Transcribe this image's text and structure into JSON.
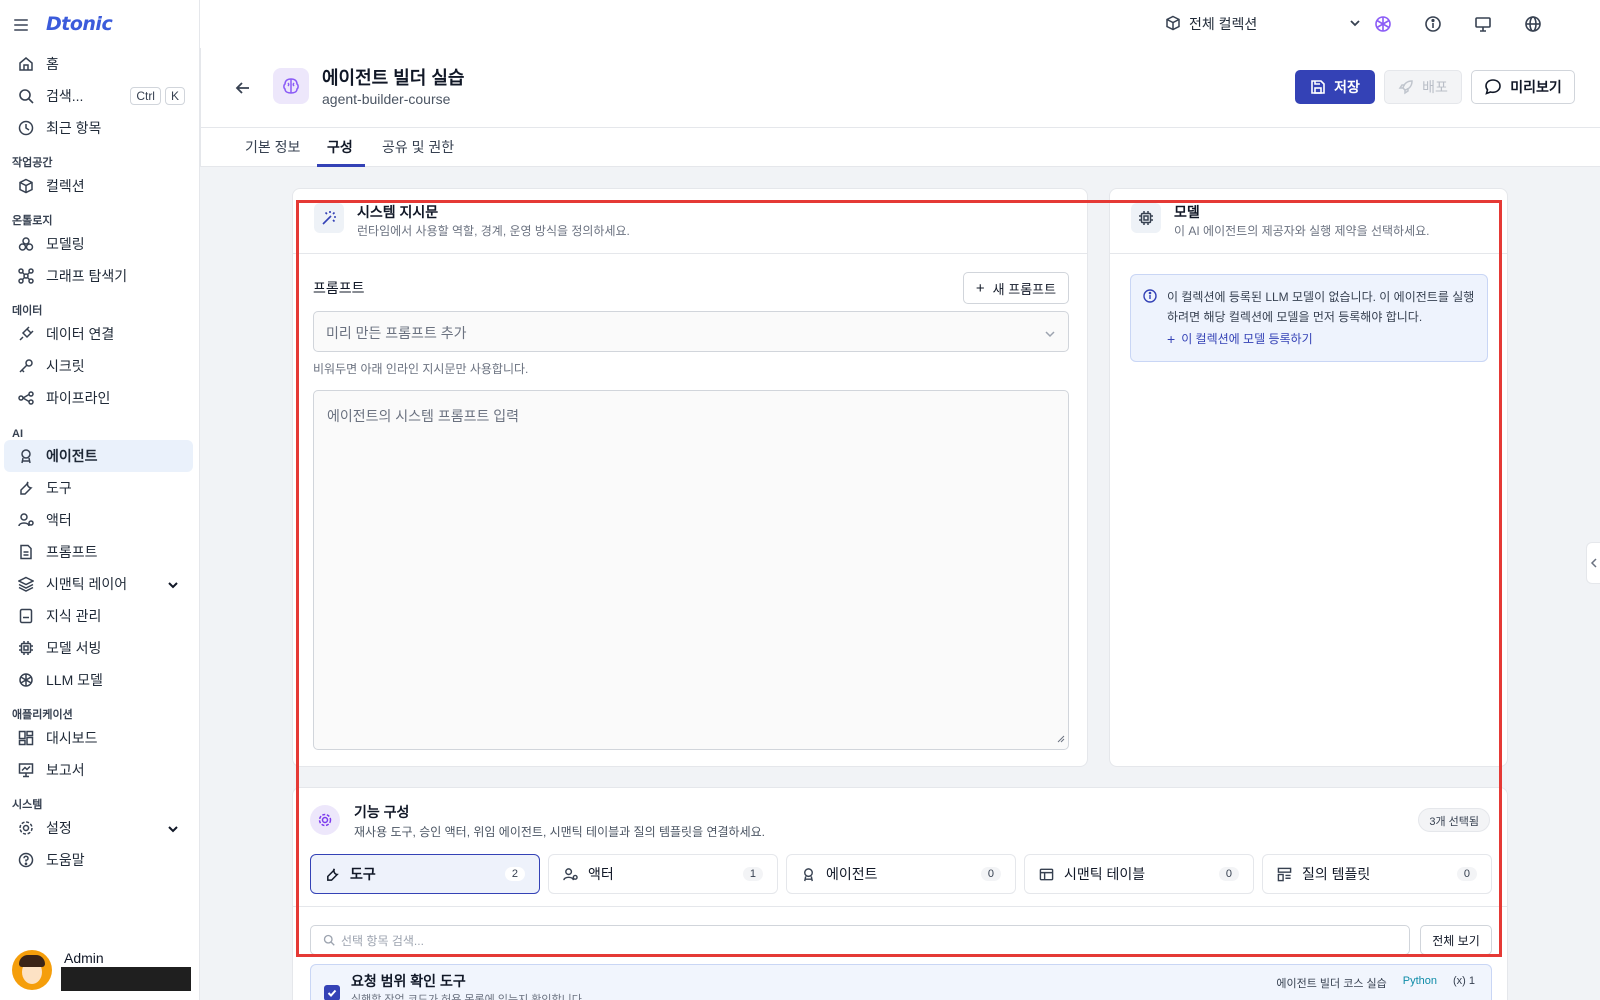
{
  "app": {
    "logo": "Dtonic"
  },
  "sidebar": {
    "home": "홈",
    "search": {
      "label": "검색...",
      "key1": "Ctrl",
      "key2": "K"
    },
    "recent": "최근 항목",
    "sections": {
      "workspace": "작업공간",
      "ontology": "온톨로지",
      "data": "데이터",
      "ai": "AI",
      "apps": "애플리케이션",
      "system": "시스템"
    },
    "items": {
      "collection": "컬렉션",
      "modeling": "모델링",
      "graph": "그래프 탐색기",
      "data_conn": "데이터 연결",
      "secret": "시크릿",
      "pipeline": "파이프라인",
      "agent": "에이전트",
      "tool": "도구",
      "actor": "액터",
      "prompt": "프롬프트",
      "semantic": "시맨틱 레이어",
      "knowledge": "지식 관리",
      "model_serving": "모델 서빙",
      "llm": "LLM 모델",
      "dashboard": "대시보드",
      "report": "보고서",
      "settings": "설정",
      "help": "도움말"
    },
    "user": {
      "name": "Admin"
    }
  },
  "topbar": {
    "collection": "전체 컬렉션"
  },
  "header": {
    "title": "에이전트 빌더 실습",
    "subtitle": "agent-builder-course",
    "save": "저장",
    "deploy": "배포",
    "preview": "미리보기"
  },
  "tabs": [
    "기본 정보",
    "구성",
    "공유 및 권한"
  ],
  "system_card": {
    "title": "시스템 지시문",
    "desc": "런타임에서 사용할 역할, 경계, 운영 방식을 정의하세요.",
    "prompt_label": "프롬프트",
    "new_prompt": "새 프롬프트",
    "select_placeholder": "미리 만든 프롬프트 추가",
    "hint": "비워두면 아래 인라인 지시문만 사용합니다.",
    "textarea_placeholder": "에이전트의 시스템 프롬프트 입력"
  },
  "model_card": {
    "title": "모델",
    "desc": "이 AI 에이전트의 제공자와 실행 제약을 선택하세요.",
    "alert": "이 컬렉션에 등록된 LLM 모델이 없습니다. 이 에이전트를 실행하려면 해당 컬렉션에 모델을 먼저 등록해야 합니다.",
    "alert_link": "이 컬렉션에 모델 등록하기"
  },
  "features": {
    "title": "기능 구성",
    "desc": "재사용 도구, 승인 액터, 위임 에이전트, 시맨틱 테이블과 질의 템플릿을 연결하세요.",
    "selected": "3개 선택됨",
    "tabs": [
      {
        "label": "도구",
        "count": "2"
      },
      {
        "label": "액터",
        "count": "1"
      },
      {
        "label": "에이전트",
        "count": "0"
      },
      {
        "label": "시맨틱 테이블",
        "count": "0"
      },
      {
        "label": "질의 템플릿",
        "count": "0"
      }
    ],
    "search_placeholder": "선택 항목 검색...",
    "view_all": "전체 보기",
    "item": {
      "title": "요청 범위 확인 도구",
      "desc": "실행할 작업 코드가 허용 목록에 있는지 확인합니다.",
      "course": "에이전트 빌더 코스 실습",
      "lang": "Python",
      "params": "(x) 1"
    }
  }
}
